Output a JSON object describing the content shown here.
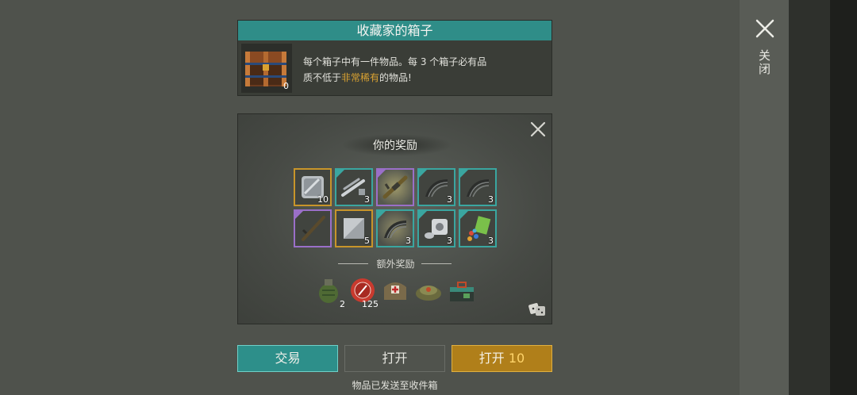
{
  "header": {
    "title": "收藏家的箱子",
    "chest_count": "0",
    "desc_line1": "每个箱子中有一件物品。每 3 个箱子必有品",
    "desc_line2_pre": "质不低于",
    "desc_line2_hl": "非常稀有",
    "desc_line2_post": "的物品!"
  },
  "side": {
    "close_label": "关闭"
  },
  "rewards": {
    "title": "你的奖励",
    "items": [
      {
        "icon": "metal-plate-icon",
        "count": "10",
        "rarity": "#c8952a"
      },
      {
        "icon": "pipes-icon",
        "count": "3",
        "rarity": "#3aa6a0"
      },
      {
        "icon": "rifle-icon",
        "count": "",
        "rarity": "#9a6fc8"
      },
      {
        "icon": "spring-parts-icon",
        "count": "3",
        "rarity": "#3aa6a0"
      },
      {
        "icon": "spring-parts-icon",
        "count": "3",
        "rarity": "#3aa6a0"
      },
      {
        "icon": "shotgun-icon",
        "count": "",
        "rarity": "#9a6fc8"
      },
      {
        "icon": "steel-plate-icon",
        "count": "5",
        "rarity": "#c8952a"
      },
      {
        "icon": "spring-parts-icon",
        "count": "3",
        "rarity": "#3aa6a0"
      },
      {
        "icon": "engine-parts-icon",
        "count": "3",
        "rarity": "#3aa6a0"
      },
      {
        "icon": "chemicals-icon",
        "count": "3",
        "rarity": "#3aa6a0"
      }
    ],
    "bonus_label": "额外奖励",
    "bonus": [
      {
        "icon": "grenade-icon",
        "count": "2"
      },
      {
        "icon": "bottle-cap-icon",
        "count": "125"
      },
      {
        "icon": "medkit-bag-icon",
        "count": ""
      },
      {
        "icon": "landmine-icon",
        "count": ""
      },
      {
        "icon": "toolbox-icon",
        "count": ""
      }
    ]
  },
  "buttons": {
    "trade": "交易",
    "open": "打开",
    "open10_label": "打开",
    "open10_num": "10"
  },
  "footer": "物品已发送至收件箱"
}
